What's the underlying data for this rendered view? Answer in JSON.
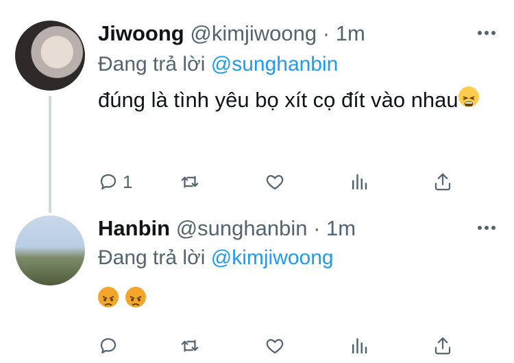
{
  "tweets": [
    {
      "name": "Jiwoong",
      "meta": "@kimjiwoong · 1m",
      "replying_prefix": "Đang trả lời ",
      "replying_to": "@sunghanbin",
      "text": "đúng là tình yêu bọ xít cọ đít vào nhau",
      "emojis": [
        "tired-face-emoji"
      ],
      "actions": {
        "reply_count": "1"
      }
    },
    {
      "name": "Hanbin",
      "meta": "@sunghanbin · 1m",
      "replying_prefix": "Đang trả lời ",
      "replying_to": "@kimjiwoong",
      "text": "",
      "emojis": [
        "angry-face-emoji",
        "angry-face-emoji"
      ],
      "actions": {
        "reply_count": ""
      }
    }
  ],
  "icons": [
    "reply-icon",
    "retweet-icon",
    "like-icon",
    "analytics-icon",
    "share-icon",
    "more-icon"
  ],
  "colors": {
    "link": "#1d9bf0",
    "secondary": "#536471",
    "text": "#0f1419",
    "thread_line": "#cfd9de"
  }
}
